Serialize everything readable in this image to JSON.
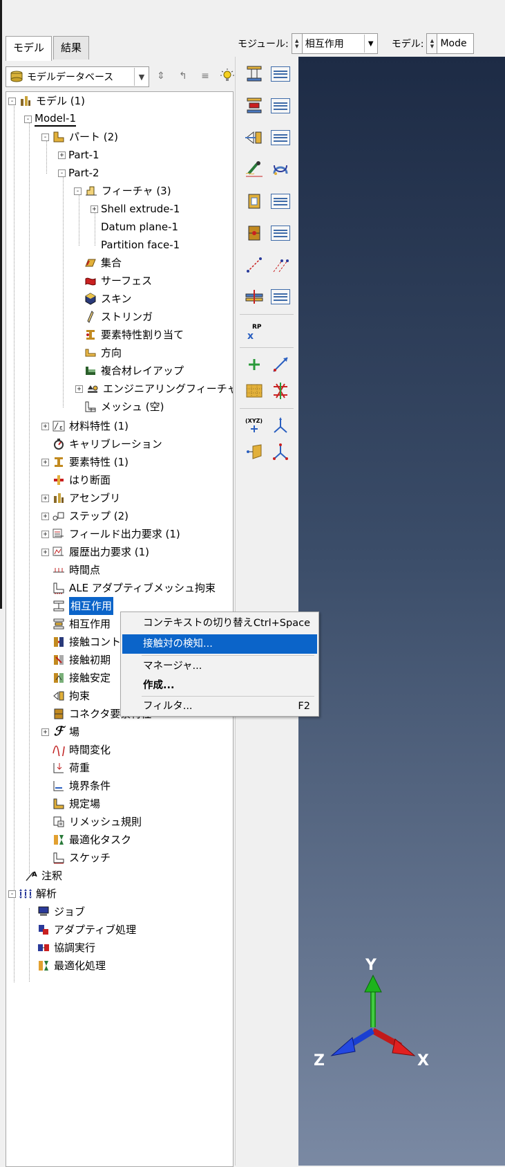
{
  "tabs": [
    "モデル",
    "結果"
  ],
  "nav_combo": {
    "value": "モデルデータベース"
  },
  "module_bar": {
    "module_label": "モジュール:",
    "module_value": "相互作用",
    "model_label": "モデル:",
    "model_value": "Mode"
  },
  "tree": {
    "model_root": "モデル (1)",
    "model1": "Model-1",
    "parts": "パート (2)",
    "part1": "Part-1",
    "part2": "Part-2",
    "features": "フィーチャ (3)",
    "shell_extrude": "Shell extrude-1",
    "datum_plane": "Datum plane-1",
    "partition_face": "Partition face-1",
    "sets": "集合",
    "surfaces": "サーフェス",
    "skins": "スキン",
    "stringers": "ストリンガ",
    "section_assign": "要素特性割り当て",
    "orientation": "方向",
    "composite": "複合材レイアップ",
    "eng_features": "エンジニアリングフィーチャ",
    "mesh": "メッシュ (空)",
    "materials": "材料特性 (1)",
    "calibration": "キャリブレーション",
    "sections": "要素特性 (1)",
    "profiles": "はり断面",
    "assembly": "アセンブリ",
    "steps": "ステップ (2)",
    "field_output": "フィールド出力要求 (1)",
    "history_output": "履歴出力要求 (1)",
    "time_points": "時間点",
    "ale": "ALE アダプティブメッシュ拘束",
    "interactions": "相互作用",
    "interaction_props": "相互作用",
    "contact_controls": "接触コント",
    "contact_init": "接触初期",
    "contact_stab": "接触安定",
    "constraints": "拘束",
    "connector_sections": "コネクタ要素特性",
    "fields": "場",
    "amplitudes": "時間変化",
    "loads": "荷重",
    "bcs": "境界条件",
    "predefined": "規定場",
    "remesh": "リメッシュ規則",
    "optimization": "最適化タスク",
    "sketches": "スケッチ",
    "annotations": "注釈",
    "analysis": "解析",
    "jobs": "ジョブ",
    "adaptivity": "アダプティブ処理",
    "coexec": "協調実行",
    "opt_process": "最適化処理"
  },
  "context_menu": {
    "switch_context": "コンテキストの切り替え",
    "switch_shortcut": "Ctrl+Space",
    "find_contact": "接触対の検知...",
    "manager": "マネージャ...",
    "create": "作成...",
    "filter": "フィルタ...",
    "filter_shortcut": "F2"
  },
  "triad": {
    "y": "Y",
    "z": "Z",
    "x": "X"
  },
  "colors": {
    "selection": "#0b64c9",
    "viewport_top": "#1d2b45",
    "viewport_bottom": "#7a89a3",
    "axis_y": "#1db31d",
    "axis_x": "#d11a1a",
    "axis_z": "#1a3fd1"
  }
}
